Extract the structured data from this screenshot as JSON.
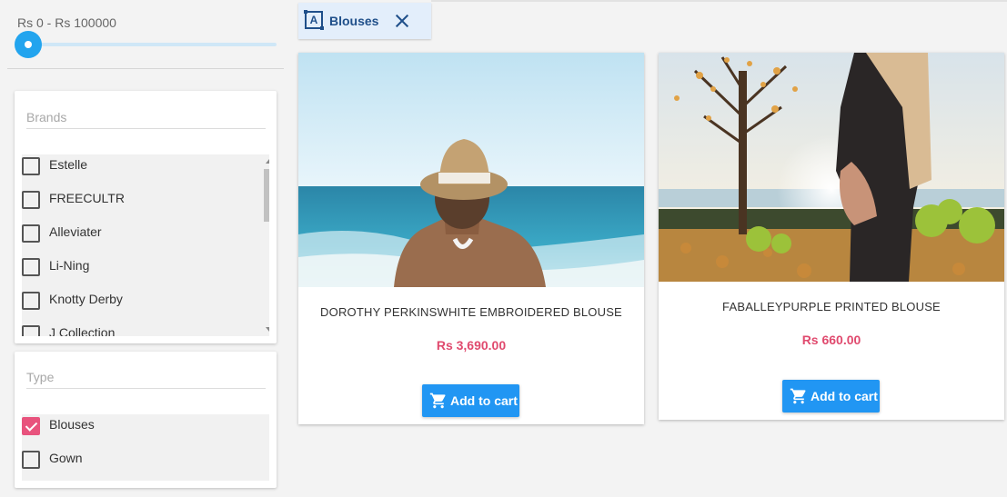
{
  "price_filter": {
    "label": "Rs 0 - Rs 100000",
    "min": 0,
    "max": 100000,
    "value": 0
  },
  "brands": {
    "placeholder": "Brands",
    "items": [
      {
        "label": "Estelle",
        "checked": false
      },
      {
        "label": "FREECULTR",
        "checked": false
      },
      {
        "label": "Alleviater",
        "checked": false
      },
      {
        "label": "Li-Ning",
        "checked": false
      },
      {
        "label": "Knotty Derby",
        "checked": false
      },
      {
        "label": "J Collection",
        "checked": false
      }
    ]
  },
  "type": {
    "placeholder": "Type",
    "items": [
      {
        "label": "Blouses",
        "checked": true
      },
      {
        "label": "Gown",
        "checked": false
      }
    ]
  },
  "active_filter": {
    "label": "Blouses",
    "icon": "label-icon",
    "close_icon": "close-icon"
  },
  "products": [
    {
      "title": "DOROTHY PERKINSWHITE EMBROIDERED BLOUSE",
      "price": "Rs 3,690.00",
      "button": "Add to cart",
      "image": "woman-hat-beach-image"
    },
    {
      "title": "FABALLEYPURPLE PRINTED BLOUSE",
      "price": "Rs 660.00",
      "button": "Add to cart",
      "image": "woman-autumn-park-image"
    }
  ],
  "colors": {
    "accent": "#2196f3",
    "price": "#e04a6e",
    "checked": "#e8537d",
    "slider": "#22a4ee",
    "chip_bg": "#e3eefb",
    "chip_text": "#1f4f8a"
  }
}
